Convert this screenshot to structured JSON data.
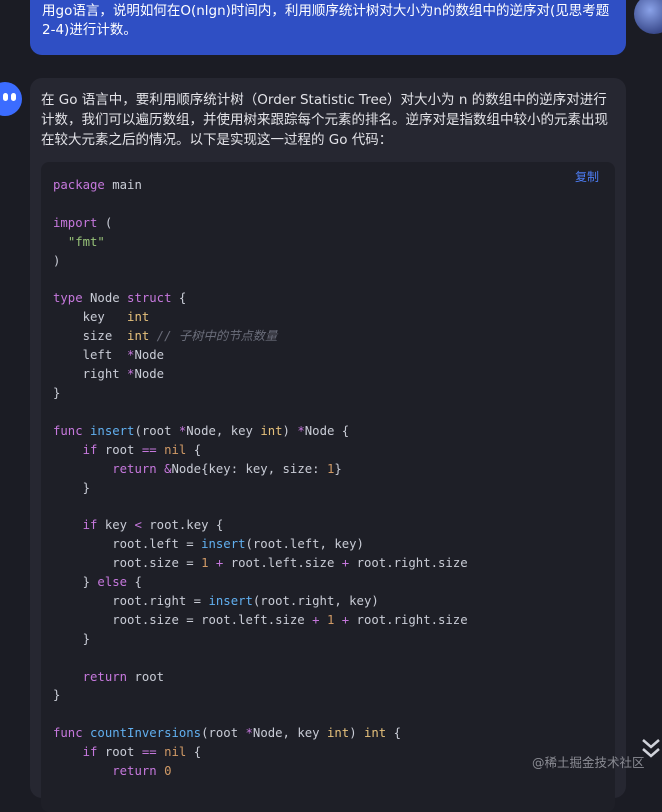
{
  "user_message": {
    "text": "用go语言，说明如何在O(nlgn)时间内，利用顺序统计树对大小为n的数组中的逆序对(见思考题2-4)进行计数。"
  },
  "assistant_message": {
    "intro": "在 Go 语言中，要利用顺序统计树（Order Statistic Tree）对大小为 n 的数组中的逆序对进行计数，我们可以遍历数组，并使用树来跟踪每个元素的排名。逆序对是指数组中较小的元素出现在较大元素之后的情况。以下是实现这一过程的 Go 代码：",
    "copy_label": "复制",
    "code_lines": [
      "package main",
      "",
      "import (",
      "  \"fmt\"",
      ")",
      "",
      "type Node struct {",
      "    key   int",
      "    size  int // 子树中的节点数量",
      "    left  *Node",
      "    right *Node",
      "}",
      "",
      "func insert(root *Node, key int) *Node {",
      "    if root == nil {",
      "        return &Node{key: key, size: 1}",
      "    }",
      "",
      "    if key < root.key {",
      "        root.left = insert(root.left, key)",
      "        root.size = 1 + root.left.size + root.right.size",
      "    } else {",
      "        root.right = insert(root.right, key)",
      "        root.size = root.left.size + 1 + root.right.size",
      "    }",
      "",
      "    return root",
      "}",
      "",
      "func countInversions(root *Node, key int) int {",
      "    if root == nil {",
      "        return 0"
    ]
  },
  "watermark": "@稀土掘金技术社区",
  "icons": {
    "scroll": "double-chevron-down-icon",
    "bot_avatar": "bot-avatar-icon",
    "user_avatar": "user-avatar-icon"
  },
  "colors": {
    "background": "#1b1c24",
    "user_bubble": "#2f4fc4",
    "assistant_card": "#262731",
    "code_bg": "#1e1f27",
    "link": "#4c7bf0"
  }
}
